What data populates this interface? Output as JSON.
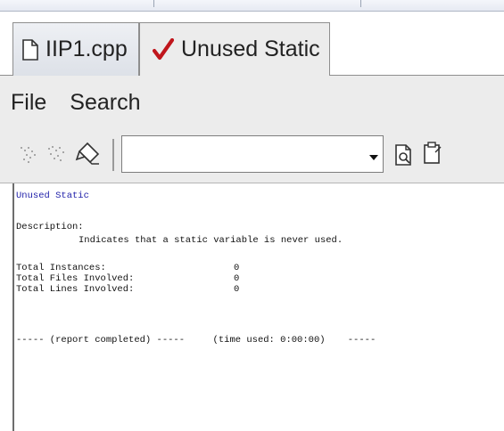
{
  "tabs": [
    {
      "label": "IIP1.cpp",
      "icon": "document-icon",
      "active": false
    },
    {
      "label": "Unused Static",
      "icon": "checkmark-icon",
      "active": true,
      "icon_color": "#c0161c"
    }
  ],
  "menu": {
    "file": "File",
    "search": "Search"
  },
  "toolbar": {
    "icons": [
      "filter-icon",
      "filter-alt-icon",
      "pointer-icon"
    ],
    "search_value": "",
    "right_icons": [
      "document-search-icon",
      "clipboard-icon"
    ]
  },
  "report": {
    "title": "Unused Static",
    "description_label": "Description:",
    "description_text": "Indicates that a static variable is never used.",
    "stats": [
      {
        "label": "Total Instances:",
        "value": "0"
      },
      {
        "label": "Total Files Involved:",
        "value": "0"
      },
      {
        "label": "Total Lines Involved:",
        "value": "0"
      }
    ],
    "footer": "----- (report completed) -----     (time used: 0:00:00)    -----"
  },
  "colors": {
    "title_text": "#2222aa",
    "check": "#c0161c",
    "panel": "#ececec"
  }
}
